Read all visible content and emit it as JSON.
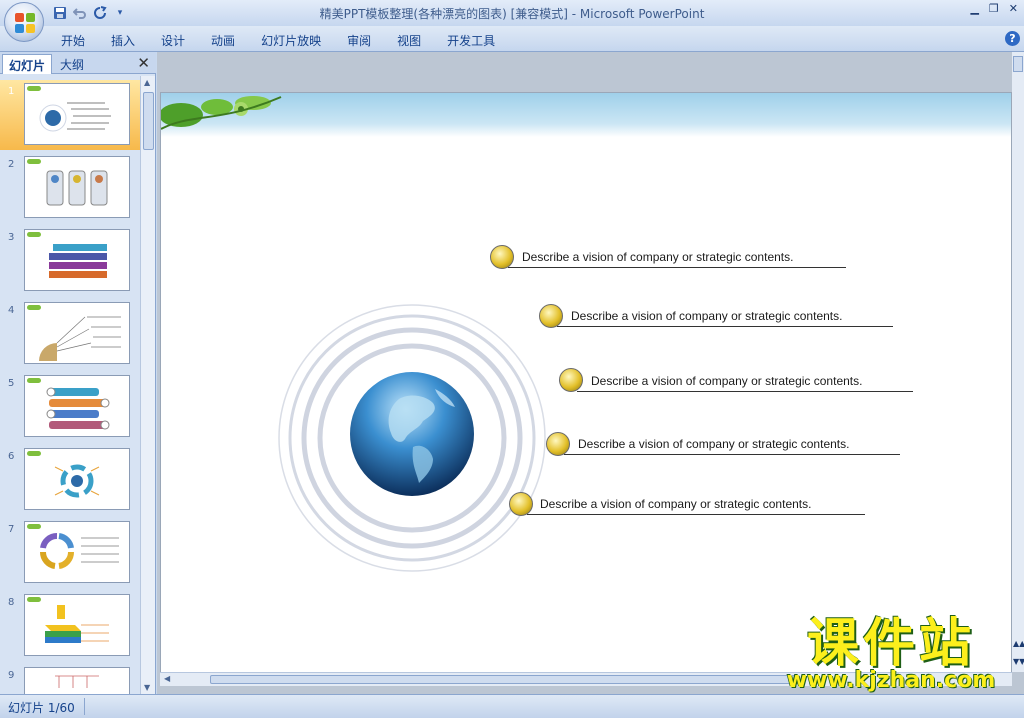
{
  "window": {
    "title": "精美PPT模板整理(各种漂亮的图表) [兼容模式] - Microsoft PowerPoint"
  },
  "quick_access": {
    "icons": [
      "save-icon",
      "undo-icon",
      "redo-icon",
      "customize-icon"
    ]
  },
  "ribbon": {
    "tabs": [
      "开始",
      "插入",
      "设计",
      "动画",
      "幻灯片放映",
      "审阅",
      "视图",
      "开发工具"
    ]
  },
  "panel": {
    "tab_slides": "幻灯片",
    "tab_outline": "大纲",
    "close_glyph": "✕",
    "selected_slide": 1,
    "thumbnails": [
      "1",
      "2",
      "3",
      "4",
      "5",
      "6",
      "7",
      "8",
      "9"
    ]
  },
  "slide": {
    "callouts": [
      "Describe a vision of company or strategic contents.",
      "Describe a vision of company or strategic contents.",
      "Describe a vision of company or strategic contents.",
      "Describe a vision of company or strategic contents.",
      "Describe a vision of company or strategic contents."
    ]
  },
  "watermark": {
    "title": "课件站",
    "url": "www.kjzhan.com"
  },
  "status": {
    "slide_counter": "幻灯片 1/60"
  },
  "colors": {
    "ribbon_bg": "#c5d6ee",
    "selected_thumb": "#f7b94b",
    "watermark_fill": "#fcef1c",
    "watermark_outline": "#1e5e16"
  }
}
